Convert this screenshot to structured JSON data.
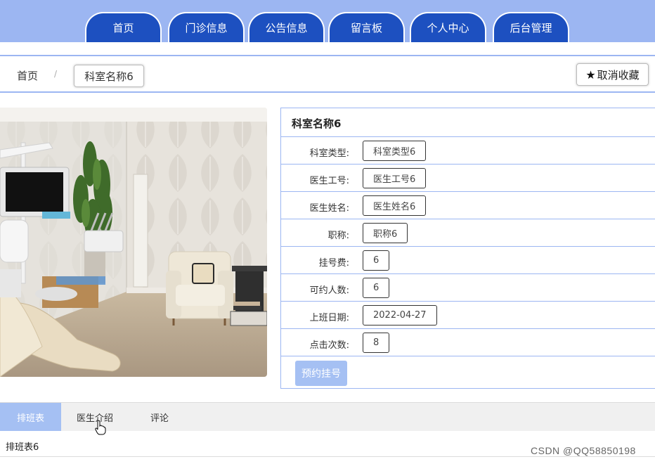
{
  "colors": {
    "nav_bg": "#9cb6f2",
    "nav_tab": "#1d50c0",
    "accent_light": "#a5c0f3"
  },
  "nav": {
    "tabs": [
      "首页",
      "门诊信息",
      "公告信息",
      "留言板",
      "个人中心",
      "后台管理"
    ]
  },
  "breadcrumb": {
    "home": "首页",
    "separator": "/",
    "current": "科室名称6"
  },
  "favorite_button": {
    "icon": "star-icon",
    "label": "取消收藏"
  },
  "photo": {
    "subject": "dental-clinic-room-photo"
  },
  "detail": {
    "title": "科室名称6",
    "fields": [
      {
        "label": "科室类型:",
        "value": "科室类型6"
      },
      {
        "label": "医生工号:",
        "value": "医生工号6"
      },
      {
        "label": "医生姓名:",
        "value": "医生姓名6"
      },
      {
        "label": "职称:",
        "value": "职称6"
      },
      {
        "label": "挂号费:",
        "value": "6"
      },
      {
        "label": "可约人数:",
        "value": "6"
      },
      {
        "label": "上班日期:",
        "value": "2022-04-27"
      },
      {
        "label": "点击次数:",
        "value": "8"
      }
    ],
    "book_button": "预约挂号"
  },
  "tabs": {
    "items": [
      "排班表",
      "医生介绍",
      "评论"
    ],
    "active_index": 0,
    "content": "排班表6"
  },
  "watermark": "CSDN @QQ58850198"
}
